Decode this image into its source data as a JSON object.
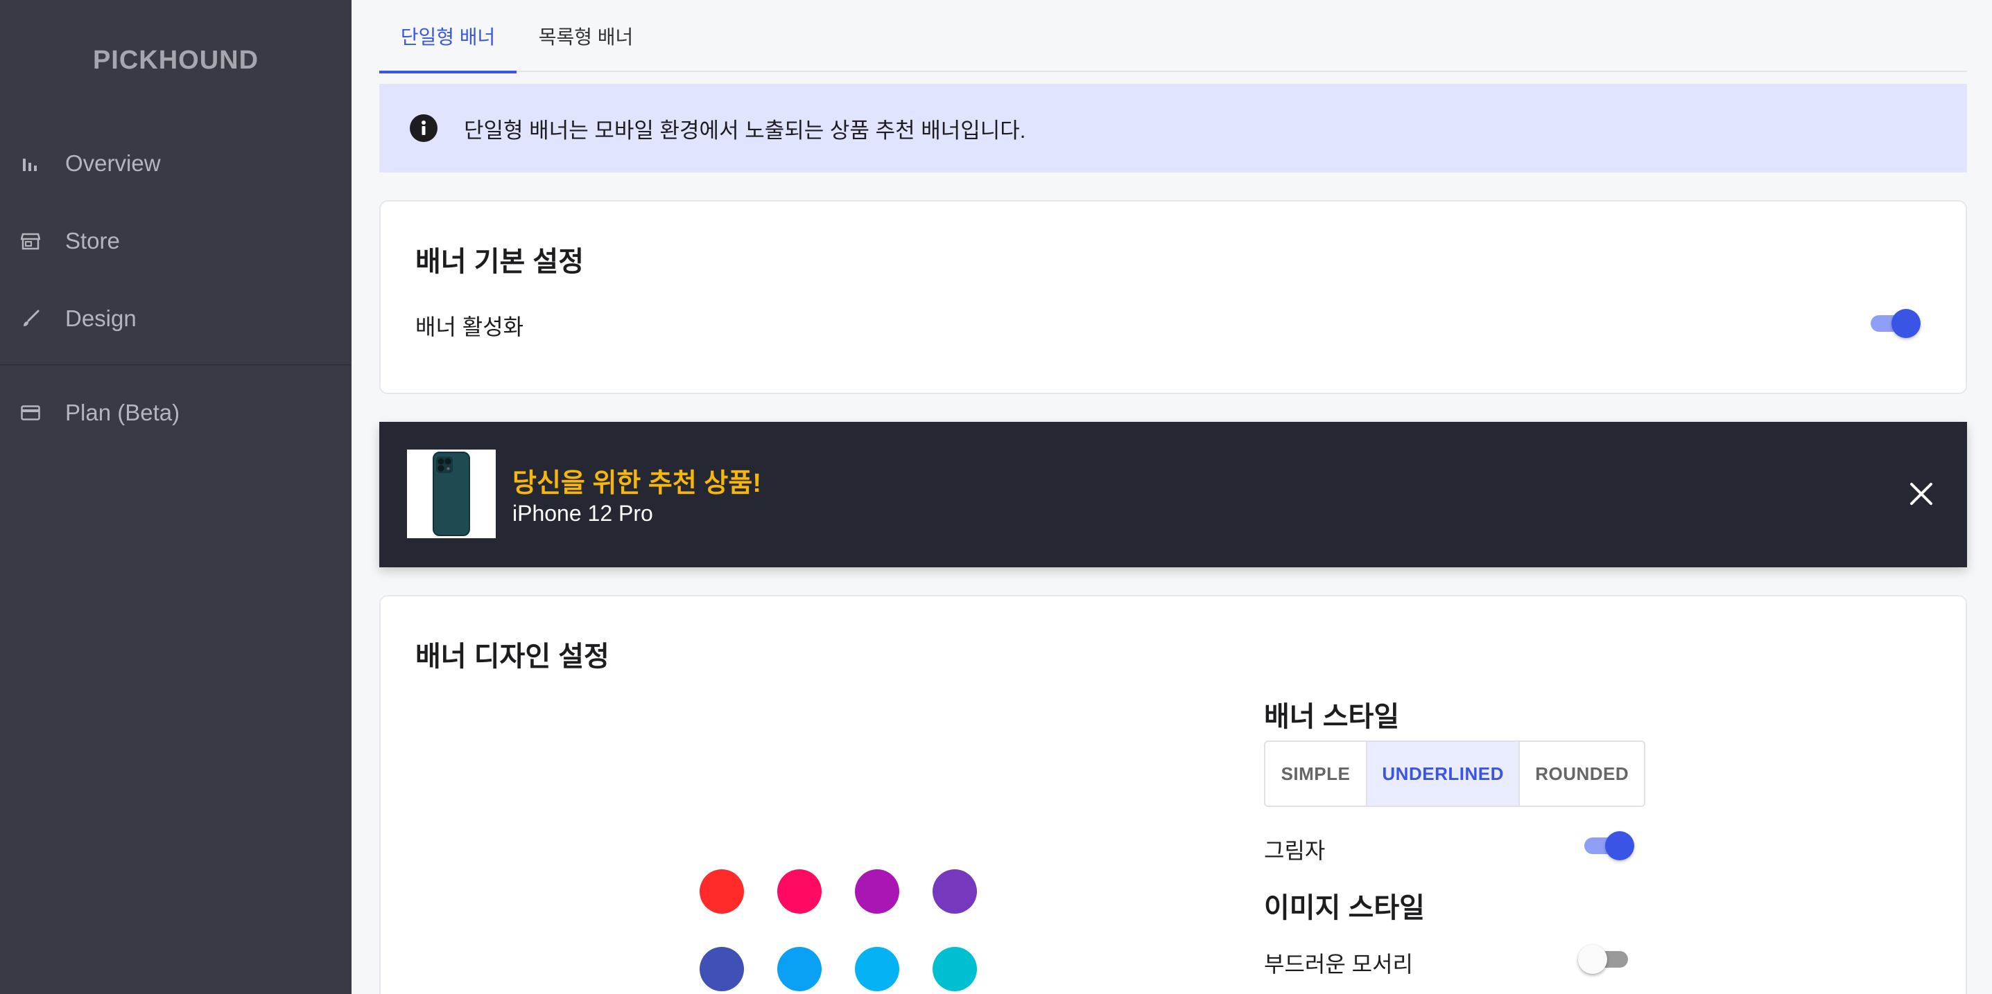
{
  "sidebar": {
    "brand": "PICKHOUND",
    "items": [
      {
        "label": "Overview",
        "icon": "bar-chart-icon"
      },
      {
        "label": "Store",
        "icon": "store-icon"
      },
      {
        "label": "Design",
        "icon": "brush-icon"
      },
      {
        "label": "Plan (Beta)",
        "icon": "credit-card-icon"
      }
    ]
  },
  "tabs": [
    {
      "label": "단일형 배너",
      "active": true
    },
    {
      "label": "목록형 배너",
      "active": false
    }
  ],
  "alert": {
    "icon": "info-icon",
    "message": "단일형 배너는 모바일 환경에서 노출되는 상품 추천 배너입니다."
  },
  "basic_settings": {
    "title": "배너 기본 설정",
    "activate_label": "배너 활성화",
    "activate_on": true
  },
  "banner_preview": {
    "headline": "당신을 위한 추천 상품!",
    "product": "iPhone 12 Pro",
    "headline_color": "#f6b60c",
    "background": "#252733",
    "close_icon": "close-icon"
  },
  "design_settings": {
    "title": "배너 디자인 설정",
    "swatches": [
      "#ff2a2a",
      "#ff0a63",
      "#aa16b3",
      "#7538be",
      "#3f51b5",
      "#0aa0f5",
      "#05b3f4",
      "#00bfd1"
    ],
    "style_title": "배너 스타일",
    "style_options": [
      "SIMPLE",
      "UNDERLINED",
      "ROUNDED"
    ],
    "style_selected": "UNDERLINED",
    "shadow_label": "그림자",
    "shadow_on": true,
    "image_style_title": "이미지 스타일",
    "rounded_label": "부드러운 모서리",
    "rounded_on": false
  },
  "colors": {
    "accent": "#3a55e6",
    "sidebar_bg": "#3a3a44",
    "alert_bg": "#e0e4ff"
  }
}
